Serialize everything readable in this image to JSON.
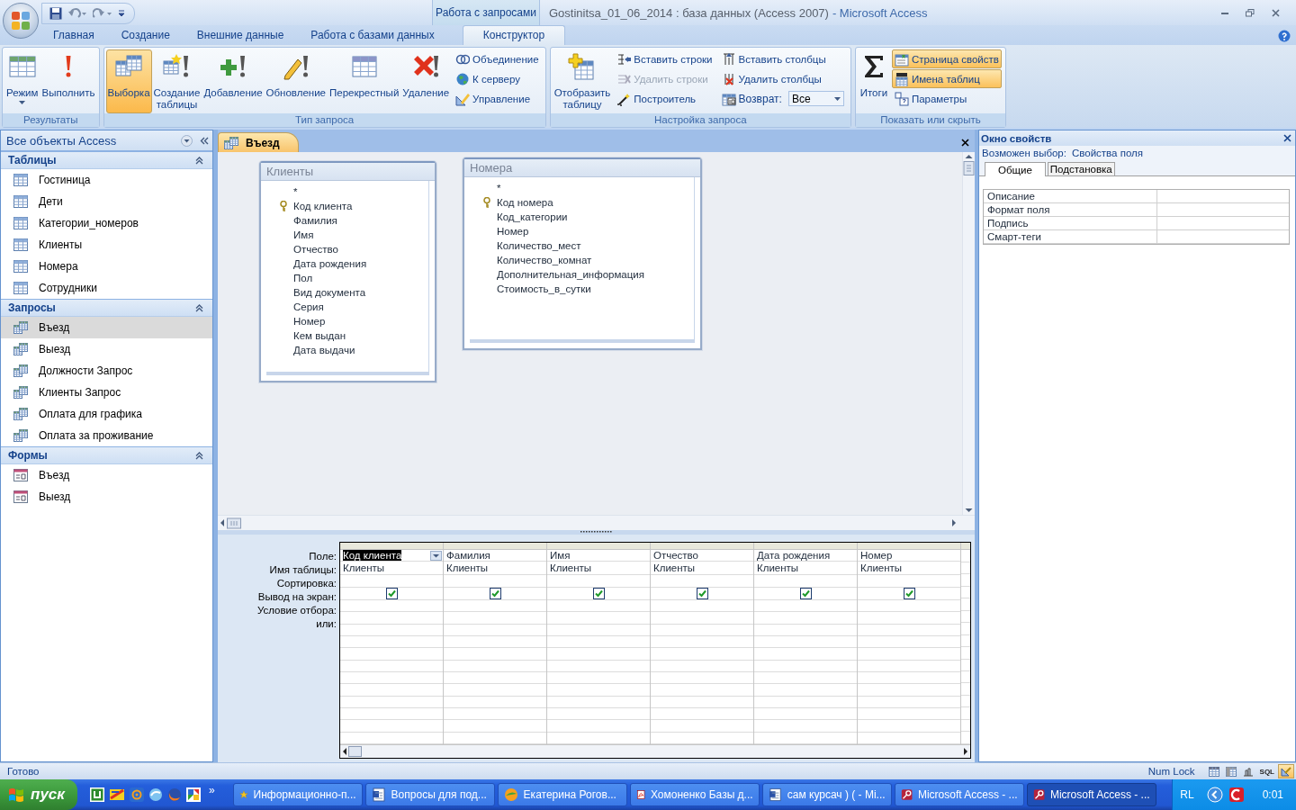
{
  "title_bar": {
    "contextual_tab": "Работа с запросами",
    "title": "Gostinitsa_01_06_2014 : база данных (Access 2007)",
    "app_name": "- Microsoft Access"
  },
  "ribbon_tabs": [
    {
      "label": "Главная",
      "selected": false
    },
    {
      "label": "Создание",
      "selected": false
    },
    {
      "label": "Внешние данные",
      "selected": false
    },
    {
      "label": "Работа с базами данных",
      "selected": false
    },
    {
      "label": "Конструктор",
      "selected": true
    }
  ],
  "ribbon_groups": [
    {
      "label": "Результаты",
      "items": [
        {
          "kind": "large",
          "label": "Режим",
          "selected": false,
          "dropdown": true
        },
        {
          "kind": "large",
          "label": "Выполнить",
          "selected": false,
          "dropdown": false
        }
      ]
    },
    {
      "label": "Тип запроса",
      "items": [
        {
          "kind": "large",
          "label": "Выборка",
          "selected": true,
          "dropdown": false
        },
        {
          "kind": "large",
          "label": "Создание\nтаблицы",
          "selected": false,
          "dropdown": false
        },
        {
          "kind": "large",
          "label": "Добавление",
          "selected": false,
          "dropdown": false
        },
        {
          "kind": "large",
          "label": "Обновление",
          "selected": false,
          "dropdown": false
        },
        {
          "kind": "large",
          "label": "Перекрестный",
          "selected": false,
          "dropdown": false
        },
        {
          "kind": "large",
          "label": "Удаление",
          "selected": false,
          "dropdown": false
        },
        {
          "kind": "stack",
          "items": [
            {
              "kind": "small",
              "label": "Объединение",
              "selected": false,
              "disabled": false
            },
            {
              "kind": "small",
              "label": "К серверу",
              "selected": false,
              "disabled": false
            },
            {
              "kind": "small",
              "label": "Управление",
              "selected": false,
              "disabled": false
            }
          ]
        }
      ]
    },
    {
      "label": "Настройка запроса",
      "items": [
        {
          "kind": "large",
          "label": "Отобразить\nтаблицу",
          "selected": false,
          "dropdown": false
        },
        {
          "kind": "stack",
          "items": [
            {
              "kind": "small",
              "label": "Вставить строки",
              "selected": false,
              "disabled": false
            },
            {
              "kind": "small",
              "label": "Удалить строки",
              "selected": false,
              "disabled": true
            },
            {
              "kind": "small",
              "label": "Построитель",
              "selected": false,
              "disabled": false
            }
          ]
        },
        {
          "kind": "stack",
          "items": [
            {
              "kind": "small",
              "label": "Вставить столбцы",
              "selected": false,
              "disabled": false
            },
            {
              "kind": "small",
              "label": "Удалить столбцы",
              "selected": false,
              "disabled": false
            },
            {
              "kind": "combo",
              "label": "Возврат:",
              "value": "Все"
            }
          ]
        }
      ]
    },
    {
      "label": "Показать или скрыть",
      "items": [
        {
          "kind": "large",
          "label": "Итоги",
          "selected": false,
          "dropdown": false
        },
        {
          "kind": "stack",
          "items": [
            {
              "kind": "small",
              "label": "Страница свойств",
              "selected": true,
              "disabled": false
            },
            {
              "kind": "small",
              "label": "Имена таблиц",
              "selected": true,
              "disabled": false
            },
            {
              "kind": "small",
              "label": "Параметры",
              "selected": false,
              "disabled": false
            }
          ]
        }
      ]
    }
  ],
  "navigation": {
    "title": "Все объекты Access",
    "sections": [
      {
        "title": "Таблицы",
        "kind": "table",
        "expanded": true,
        "items": [
          {
            "label": "Гостиница",
            "selected": false
          },
          {
            "label": "Дети",
            "selected": false
          },
          {
            "label": "Категории_номеров",
            "selected": false
          },
          {
            "label": "Клиенты",
            "selected": false
          },
          {
            "label": "Номера",
            "selected": false
          },
          {
            "label": "Сотрудники",
            "selected": false
          }
        ]
      },
      {
        "title": "Запросы",
        "kind": "query",
        "expanded": true,
        "items": [
          {
            "label": "Въезд",
            "selected": true
          },
          {
            "label": "Выезд",
            "selected": false
          },
          {
            "label": "Должности Запрос",
            "selected": false
          },
          {
            "label": "Клиенты Запрос",
            "selected": false
          },
          {
            "label": "Оплата для графика",
            "selected": false
          },
          {
            "label": "Оплата за проживание",
            "selected": false
          }
        ]
      },
      {
        "title": "Формы",
        "kind": "form",
        "expanded": true,
        "items": [
          {
            "label": "Въезд",
            "selected": false
          },
          {
            "label": "Выезд",
            "selected": false
          }
        ]
      }
    ]
  },
  "document_tab": {
    "label": "Въезд"
  },
  "field_lists": [
    {
      "title": "Клиенты",
      "fields": [
        {
          "name": "*",
          "key": false
        },
        {
          "name": "Код клиента",
          "key": true
        },
        {
          "name": "Фамилия",
          "key": false
        },
        {
          "name": "Имя",
          "key": false
        },
        {
          "name": "Отчество",
          "key": false
        },
        {
          "name": "Дата рождения",
          "key": false
        },
        {
          "name": "Пол",
          "key": false
        },
        {
          "name": "Вид документа",
          "key": false
        },
        {
          "name": "Серия",
          "key": false
        },
        {
          "name": "Номер",
          "key": false
        },
        {
          "name": "Кем выдан",
          "key": false
        },
        {
          "name": "Дата выдачи",
          "key": false
        }
      ]
    },
    {
      "title": "Номера",
      "fields": [
        {
          "name": "*",
          "key": false
        },
        {
          "name": "Код номера",
          "key": true
        },
        {
          "name": "Код_категории",
          "key": false
        },
        {
          "name": "Номер",
          "key": false
        },
        {
          "name": "Количество_мест",
          "key": false
        },
        {
          "name": "Количество_комнат",
          "key": false
        },
        {
          "name": "Дополнительная_информация",
          "key": false
        },
        {
          "name": "Стоимость_в_сутки",
          "key": false
        }
      ]
    }
  ],
  "grid_row_labels": [
    "Поле:",
    "Имя таблицы:",
    "Сортировка:",
    "Вывод на экран:",
    "Условие отбора:",
    "или:"
  ],
  "grid_columns": [
    {
      "field": "Код клиента",
      "table": "Клиенты",
      "show": true,
      "selected": true
    },
    {
      "field": "Фамилия",
      "table": "Клиенты",
      "show": true,
      "selected": false
    },
    {
      "field": "Имя",
      "table": "Клиенты",
      "show": true,
      "selected": false
    },
    {
      "field": "Отчество",
      "table": "Клиенты",
      "show": true,
      "selected": false
    },
    {
      "field": "Дата рождения",
      "table": "Клиенты",
      "show": true,
      "selected": false
    },
    {
      "field": "Номер",
      "table": "Клиенты",
      "show": true,
      "selected": false
    }
  ],
  "property_sheet": {
    "title": "Окно свойств",
    "selection_label": "Возможен выбор:",
    "selection": "Свойства поля",
    "tabs": [
      {
        "label": "Общие",
        "selected": true
      },
      {
        "label": "Подстановка",
        "selected": false
      }
    ],
    "properties": [
      {
        "name": "Описание"
      },
      {
        "name": "Формат поля"
      },
      {
        "name": "Подпись"
      },
      {
        "name": "Смарт-теги"
      }
    ]
  },
  "status_bar": {
    "text": "Готово",
    "num_lock": "Num Lock",
    "views": [
      {
        "kind": "datasheet",
        "selected": false
      },
      {
        "kind": "pivot-table",
        "selected": false
      },
      {
        "kind": "pivot-chart",
        "selected": false
      },
      {
        "kind": "sql",
        "label": "SQL",
        "selected": false
      },
      {
        "kind": "design",
        "selected": true
      }
    ]
  },
  "taskbar": {
    "start": "пуск",
    "more": "»",
    "tasks": [
      {
        "kind": "star",
        "label": "Информационно-п...",
        "selected": false
      },
      {
        "kind": "document",
        "label": "Вопросы для под...",
        "selected": false
      },
      {
        "kind": "chat",
        "label": "Екатерина Рогов...",
        "selected": false
      },
      {
        "kind": "pdf",
        "label": "Хомоненко Базы д...",
        "selected": false
      },
      {
        "kind": "document",
        "label": "сам курсач ) ( - Mi...",
        "selected": false
      },
      {
        "kind": "access",
        "label": "Microsoft Access - ...",
        "selected": false
      },
      {
        "kind": "access",
        "label": "Microsoft Access - ...",
        "selected": true
      }
    ],
    "language": "RL",
    "clock": "0:01"
  }
}
